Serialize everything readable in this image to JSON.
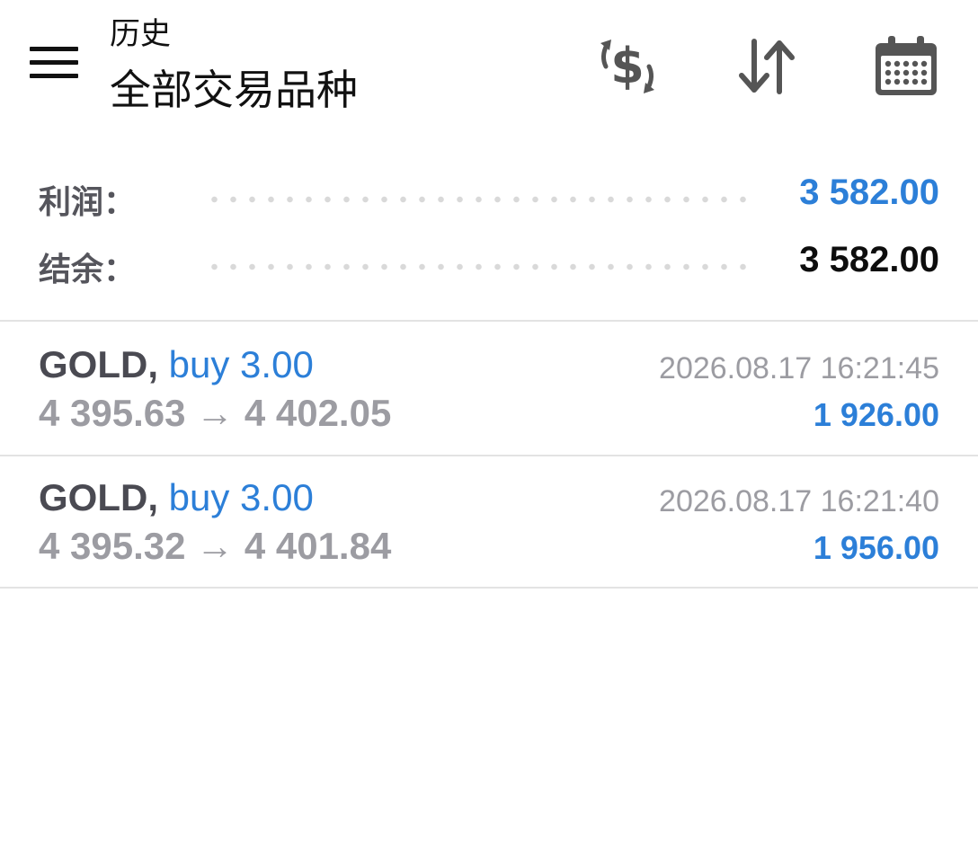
{
  "header": {
    "subtitle": "历史",
    "title": "全部交易品种"
  },
  "icons": {
    "menu": "menu-icon",
    "deposit": "dollar-exchange-icon",
    "sort": "sort-arrows-icon",
    "calendar": "calendar-icon"
  },
  "summary": {
    "profit_label": "利润：",
    "profit_value": "3 582.00",
    "balance_label": "结余：",
    "balance_value": "3 582.00"
  },
  "trades": [
    {
      "symbol": "GOLD,",
      "side": "buy 3.00",
      "prices": "4 395.63 → 4 402.05",
      "time": "2026.08.17 16:21:45",
      "profit": "1 926.00"
    },
    {
      "symbol": "GOLD,",
      "side": "buy 3.00",
      "prices": "4 395.32 → 4 401.84",
      "time": "2026.08.17 16:21:40",
      "profit": "1 956.00"
    }
  ],
  "colors": {
    "accent": "#2c7fd8",
    "icon": "#555555",
    "muted": "#9c9ca2",
    "divider": "#e3e3e3"
  }
}
